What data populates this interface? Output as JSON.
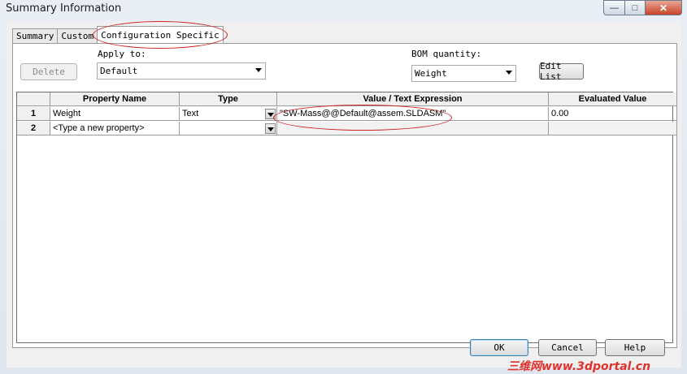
{
  "window": {
    "title": "Summary Information"
  },
  "tabs": [
    {
      "label": "Summary"
    },
    {
      "label": "Custom"
    },
    {
      "label": "Configuration Specific"
    }
  ],
  "toolbar": {
    "delete_label": "Delete",
    "apply_to_label": "Apply to:",
    "apply_to_value": "Default",
    "bom_quantity_label": "BOM quantity:",
    "bom_quantity_value": "Weight",
    "edit_list_label": "Edit List"
  },
  "table": {
    "columns": [
      "",
      "Property Name",
      "Type",
      "Value / Text Expression",
      "Evaluated Value"
    ],
    "rows": [
      {
        "num": "1",
        "name": "Weight",
        "type": "Text",
        "value": "\"SW-Mass@@Default@assem.SLDASM\"",
        "evaluated": "0.00"
      },
      {
        "num": "2",
        "name": "<Type a new property>",
        "type": "",
        "value": "",
        "evaluated": ""
      }
    ]
  },
  "footer": {
    "ok_label": "OK",
    "cancel_label": "Cancel",
    "help_label": "Help"
  },
  "watermark": "三维网www.3dportal.cn",
  "colors": {
    "annotation": "#cc2020",
    "watermark": "#e0322c"
  }
}
